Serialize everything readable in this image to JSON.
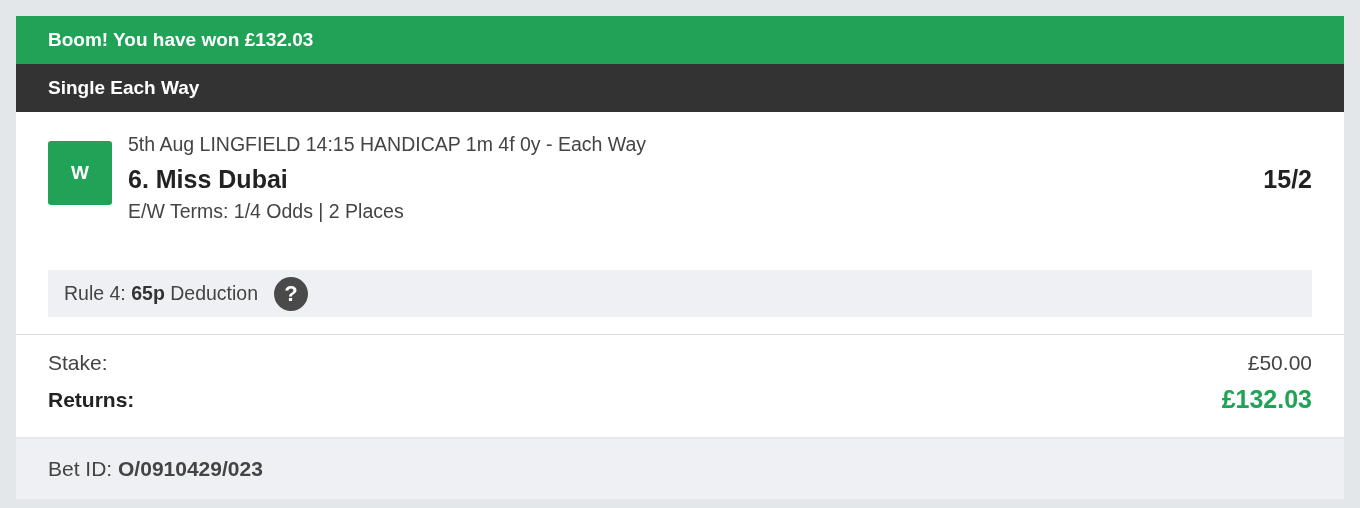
{
  "banner": {
    "text": "Boom! You have won £132.03"
  },
  "bet_type": "Single Each Way",
  "selection": {
    "result": "W",
    "won": true,
    "event": "5th Aug LINGFIELD 14:15 HANDICAP 1m 4f 0y - Each Way",
    "runner": "6. Miss Dubai",
    "odds": "15/2",
    "terms": "E/W Terms: 1/4 Odds | 2 Places"
  },
  "rule4": {
    "text": "Rule 4: **65p** Deduction",
    "help": "?"
  },
  "totals": [
    {
      "label": "Stake:",
      "value": "£50.00",
      "kind": "plain"
    },
    {
      "label": "Returns:",
      "value": "£132.03",
      "kind": "total"
    }
  ],
  "bet_id": "Bet ID: **O/0910429/023**"
}
